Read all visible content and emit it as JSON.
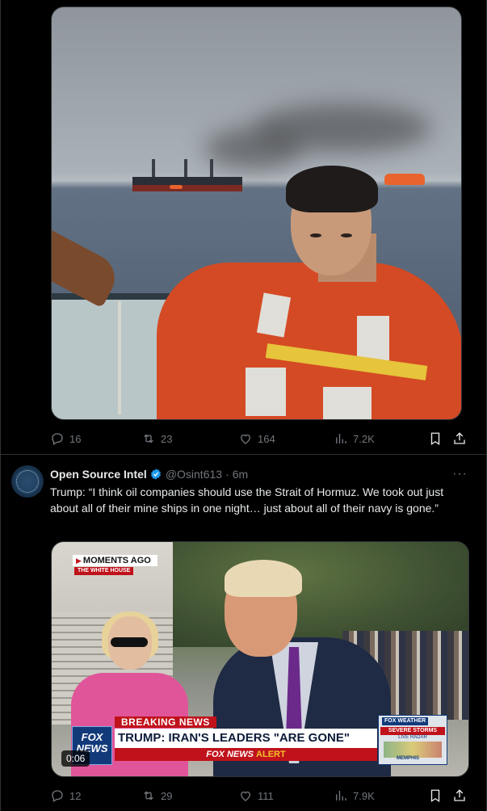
{
  "tweet1": {
    "actions": {
      "replies": "16",
      "reposts": "23",
      "likes": "164",
      "views": "7.2K"
    }
  },
  "tweet2": {
    "author": {
      "name": "Open Source Intel",
      "handle": "@Osint613",
      "time": "6m"
    },
    "text": "Trump: “I think oil companies should use the Strait of Hormuz. We took out just about all of their mine ships in one night… just about all of their navy is gone.”",
    "video": {
      "moments_label": "MOMENTS AGO",
      "location_label": "THE WHITE HOUSE",
      "breaking_label": "BREAKING NEWS",
      "headline": "TRUMP: IRAN'S LEADERS \"ARE GONE\"",
      "alert_brand": "FOX NEWS",
      "alert_word": "ALERT",
      "network_logo": "FOX NEWS",
      "weather_title": "FOX WEATHER",
      "weather_headline": "SEVERE STORMS",
      "weather_sub": "LIVE RADAR",
      "weather_city": "MEMPHIS",
      "timer": "0:06"
    },
    "actions": {
      "replies": "12",
      "reposts": "29",
      "likes": "111",
      "views": "7.9K"
    }
  },
  "colors": {
    "background": "#000000",
    "muted": "#71767b",
    "verified": "#1d9bf0",
    "text": "#e7e9ea"
  },
  "icons": [
    "reply-icon",
    "repost-icon",
    "like-icon",
    "views-icon",
    "bookmark-icon",
    "share-icon",
    "verified-icon",
    "more-icon"
  ]
}
